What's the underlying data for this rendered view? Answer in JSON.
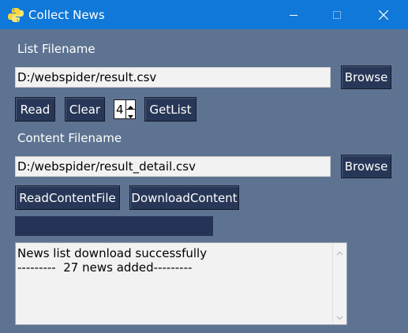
{
  "window": {
    "title": "Collect News",
    "app_icon": "python-icon",
    "controls": [
      "minimize-icon",
      "maximize-icon",
      "close-icon"
    ]
  },
  "list_section": {
    "label": "List Filename",
    "filename_value": "D:/webspider/result.csv",
    "browse_label": "Browse",
    "read_label": "Read",
    "clear_label": "Clear",
    "spinbox_value": "4",
    "getlist_label": "GetList"
  },
  "content_section": {
    "label": "Content Filename",
    "filename_value": "D:/webspider/result_detail.csv",
    "browse_label": "Browse",
    "read_content_label": "ReadContentFile",
    "download_content_label": "DownloadContent"
  },
  "progress": {
    "value": 0
  },
  "log": {
    "lines": [
      "News list download successfully",
      "---------  27 news added---------"
    ]
  },
  "colors": {
    "titlebar": "#0f78d8",
    "window_bg": "#5e7391",
    "button_bg": "#283757",
    "progress_track": "#253456"
  }
}
